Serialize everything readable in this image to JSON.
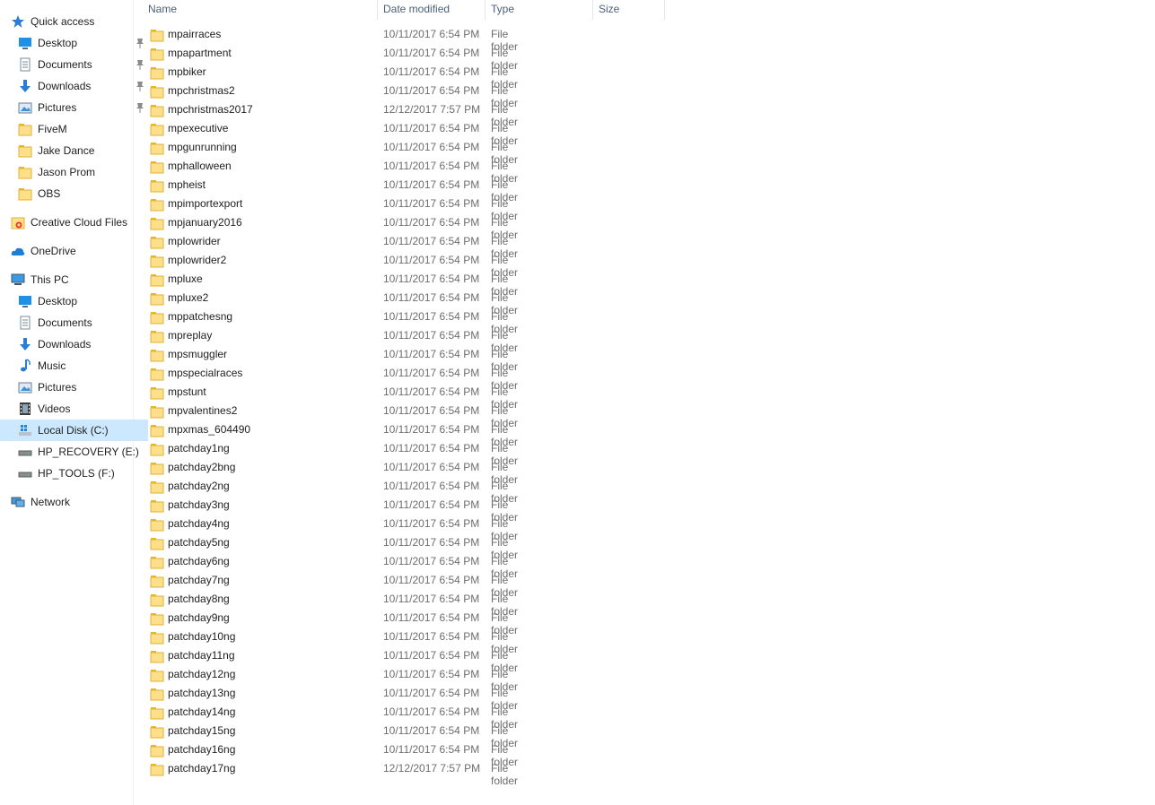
{
  "colors": {
    "selected_bg": "#cce8ff",
    "folder": "#ffe08a"
  },
  "nav": [
    {
      "label": "Quick access",
      "icon": "star-icon",
      "lvl": 0,
      "pin": false
    },
    {
      "label": "Desktop",
      "icon": "desktop-icon",
      "lvl": 1,
      "pin": true
    },
    {
      "label": "Documents",
      "icon": "documents-icon",
      "lvl": 1,
      "pin": true
    },
    {
      "label": "Downloads",
      "icon": "download-icon",
      "lvl": 1,
      "pin": true
    },
    {
      "label": "Pictures",
      "icon": "pictures-icon",
      "lvl": 1,
      "pin": true
    },
    {
      "label": "FiveM",
      "icon": "folder-icon",
      "lvl": 1,
      "pin": false
    },
    {
      "label": "Jake Dance",
      "icon": "folder-icon",
      "lvl": 1,
      "pin": false
    },
    {
      "label": "Jason Prom",
      "icon": "folder-icon",
      "lvl": 1,
      "pin": false
    },
    {
      "label": "OBS",
      "icon": "folder-icon",
      "lvl": 1,
      "pin": false
    },
    {
      "label": "Creative Cloud Files",
      "icon": "creative-cloud-icon",
      "lvl": 0,
      "pin": false
    },
    {
      "label": "OneDrive",
      "icon": "cloud-icon",
      "lvl": 0,
      "pin": false
    },
    {
      "label": "This PC",
      "icon": "computer-icon",
      "lvl": 0,
      "pin": false
    },
    {
      "label": "Desktop",
      "icon": "desktop-icon",
      "lvl": 1,
      "pin": false
    },
    {
      "label": "Documents",
      "icon": "documents-icon",
      "lvl": 1,
      "pin": false
    },
    {
      "label": "Downloads",
      "icon": "download-icon",
      "lvl": 1,
      "pin": false
    },
    {
      "label": "Music",
      "icon": "music-icon",
      "lvl": 1,
      "pin": false
    },
    {
      "label": "Pictures",
      "icon": "pictures-icon",
      "lvl": 1,
      "pin": false
    },
    {
      "label": "Videos",
      "icon": "videos-icon",
      "lvl": 1,
      "pin": false
    },
    {
      "label": "Local Disk (C:)",
      "icon": "windows-drive-icon",
      "lvl": 1,
      "pin": false,
      "selected": true
    },
    {
      "label": "HP_RECOVERY (E:)",
      "icon": "drive-icon",
      "lvl": 1,
      "pin": false
    },
    {
      "label": "HP_TOOLS (F:)",
      "icon": "drive-icon",
      "lvl": 1,
      "pin": false
    },
    {
      "label": "Network",
      "icon": "network-icon",
      "lvl": 0,
      "pin": false
    }
  ],
  "columns": {
    "name": "Name",
    "date": "Date modified",
    "type": "Type",
    "size": "Size"
  },
  "files": [
    {
      "name": "mpairraces",
      "date": "10/11/2017 6:54 PM",
      "type": "File folder"
    },
    {
      "name": "mpapartment",
      "date": "10/11/2017 6:54 PM",
      "type": "File folder"
    },
    {
      "name": "mpbiker",
      "date": "10/11/2017 6:54 PM",
      "type": "File folder"
    },
    {
      "name": "mpchristmas2",
      "date": "10/11/2017 6:54 PM",
      "type": "File folder"
    },
    {
      "name": "mpchristmas2017",
      "date": "12/12/2017 7:57 PM",
      "type": "File folder"
    },
    {
      "name": "mpexecutive",
      "date": "10/11/2017 6:54 PM",
      "type": "File folder"
    },
    {
      "name": "mpgunrunning",
      "date": "10/11/2017 6:54 PM",
      "type": "File folder"
    },
    {
      "name": "mphalloween",
      "date": "10/11/2017 6:54 PM",
      "type": "File folder"
    },
    {
      "name": "mpheist",
      "date": "10/11/2017 6:54 PM",
      "type": "File folder"
    },
    {
      "name": "mpimportexport",
      "date": "10/11/2017 6:54 PM",
      "type": "File folder"
    },
    {
      "name": "mpjanuary2016",
      "date": "10/11/2017 6:54 PM",
      "type": "File folder"
    },
    {
      "name": "mplowrider",
      "date": "10/11/2017 6:54 PM",
      "type": "File folder"
    },
    {
      "name": "mplowrider2",
      "date": "10/11/2017 6:54 PM",
      "type": "File folder"
    },
    {
      "name": "mpluxe",
      "date": "10/11/2017 6:54 PM",
      "type": "File folder"
    },
    {
      "name": "mpluxe2",
      "date": "10/11/2017 6:54 PM",
      "type": "File folder"
    },
    {
      "name": "mppatchesng",
      "date": "10/11/2017 6:54 PM",
      "type": "File folder"
    },
    {
      "name": "mpreplay",
      "date": "10/11/2017 6:54 PM",
      "type": "File folder"
    },
    {
      "name": "mpsmuggler",
      "date": "10/11/2017 6:54 PM",
      "type": "File folder"
    },
    {
      "name": "mpspecialraces",
      "date": "10/11/2017 6:54 PM",
      "type": "File folder"
    },
    {
      "name": "mpstunt",
      "date": "10/11/2017 6:54 PM",
      "type": "File folder"
    },
    {
      "name": "mpvalentines2",
      "date": "10/11/2017 6:54 PM",
      "type": "File folder"
    },
    {
      "name": "mpxmas_604490",
      "date": "10/11/2017 6:54 PM",
      "type": "File folder"
    },
    {
      "name": "patchday1ng",
      "date": "10/11/2017 6:54 PM",
      "type": "File folder"
    },
    {
      "name": "patchday2bng",
      "date": "10/11/2017 6:54 PM",
      "type": "File folder"
    },
    {
      "name": "patchday2ng",
      "date": "10/11/2017 6:54 PM",
      "type": "File folder"
    },
    {
      "name": "patchday3ng",
      "date": "10/11/2017 6:54 PM",
      "type": "File folder"
    },
    {
      "name": "patchday4ng",
      "date": "10/11/2017 6:54 PM",
      "type": "File folder"
    },
    {
      "name": "patchday5ng",
      "date": "10/11/2017 6:54 PM",
      "type": "File folder"
    },
    {
      "name": "patchday6ng",
      "date": "10/11/2017 6:54 PM",
      "type": "File folder"
    },
    {
      "name": "patchday7ng",
      "date": "10/11/2017 6:54 PM",
      "type": "File folder"
    },
    {
      "name": "patchday8ng",
      "date": "10/11/2017 6:54 PM",
      "type": "File folder"
    },
    {
      "name": "patchday9ng",
      "date": "10/11/2017 6:54 PM",
      "type": "File folder"
    },
    {
      "name": "patchday10ng",
      "date": "10/11/2017 6:54 PM",
      "type": "File folder"
    },
    {
      "name": "patchday11ng",
      "date": "10/11/2017 6:54 PM",
      "type": "File folder"
    },
    {
      "name": "patchday12ng",
      "date": "10/11/2017 6:54 PM",
      "type": "File folder"
    },
    {
      "name": "patchday13ng",
      "date": "10/11/2017 6:54 PM",
      "type": "File folder"
    },
    {
      "name": "patchday14ng",
      "date": "10/11/2017 6:54 PM",
      "type": "File folder"
    },
    {
      "name": "patchday15ng",
      "date": "10/11/2017 6:54 PM",
      "type": "File folder"
    },
    {
      "name": "patchday16ng",
      "date": "10/11/2017 6:54 PM",
      "type": "File folder"
    },
    {
      "name": "patchday17ng",
      "date": "12/12/2017 7:57 PM",
      "type": "File folder"
    }
  ]
}
